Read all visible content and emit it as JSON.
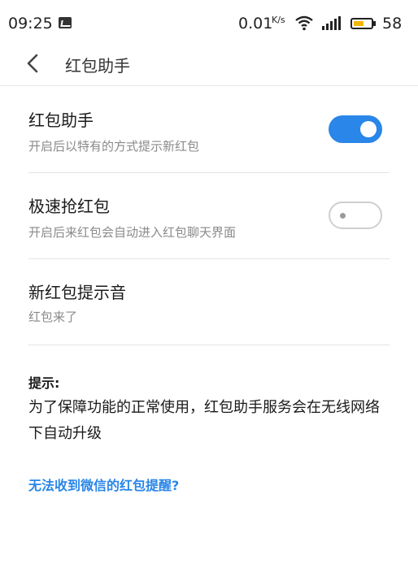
{
  "status_bar": {
    "time": "09:25",
    "net_speed": "0.01",
    "net_speed_unit": "K/s",
    "battery": "58",
    "battery_fill_fraction": 0.58,
    "battery_color": "#f2b705"
  },
  "header": {
    "back_icon": "chevron-left-icon",
    "title": "红包助手"
  },
  "settings": [
    {
      "title": "红包助手",
      "subtitle": "开启后以特有的方式提示新红包",
      "toggle": true
    },
    {
      "title": "极速抢红包",
      "subtitle": "开启后来红包会自动进入红包聊天界面",
      "toggle": false
    },
    {
      "title": "新红包提示音",
      "subtitle": "红包来了"
    }
  ],
  "tip": {
    "label": "提示:",
    "text": "为了保障功能的正常使用，红包助手服务会在无线网络下自动升级"
  },
  "help_link": "无法收到微信的红包提醒?",
  "colors": {
    "accent": "#2a86e8",
    "toggle_off_border": "#cfcfcf"
  }
}
